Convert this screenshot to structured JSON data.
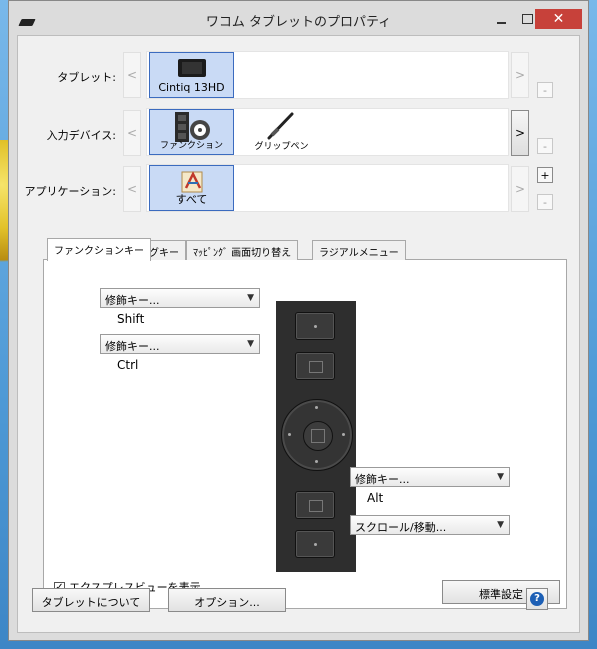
{
  "window": {
    "title": "ワコム タブレットのプロパティ",
    "close_glyph": "✕"
  },
  "rows": {
    "tablet": {
      "label": "タブレット:",
      "prev": "<",
      "next": ">",
      "minus": "-",
      "items": [
        {
          "label": "Cintiq 13HD",
          "icon": "tablet-icon",
          "selected": true
        }
      ]
    },
    "input_device": {
      "label": "入力デバイス:",
      "prev": "<",
      "next": ">",
      "minus": "-",
      "items": [
        {
          "label": "ファンクション",
          "icon": "express-keys-icon",
          "selected": true
        },
        {
          "label": "グリップペン",
          "icon": "grip-pen-icon",
          "selected": false
        }
      ]
    },
    "application": {
      "label": "アプリケーション:",
      "prev": "<",
      "next": ">",
      "plus": "+",
      "minus": "-",
      "items": [
        {
          "label": "すべて",
          "icon": "all-applications-icon",
          "selected": true
        }
      ]
    }
  },
  "tabs": [
    {
      "label": "ファンクションキー",
      "active": true
    },
    {
      "label": "リングキー",
      "active": false
    },
    {
      "label": "ﾏｯﾋﾟﾝｸﾞ 画面切り替え",
      "active": false
    },
    {
      "label": "ラジアルメニュー",
      "active": false
    }
  ],
  "function_keys": {
    "top1": {
      "value": "修飾キー...",
      "sub": "Shift"
    },
    "top2": {
      "value": "修飾キー...",
      "sub": "Ctrl"
    },
    "bottom1": {
      "value": "修飾キー...",
      "sub": "Alt"
    },
    "bottom2": {
      "value": "スクロール/移動..."
    }
  },
  "express_view": {
    "label": "エクスプレスビューを表示",
    "checked": true,
    "check_glyph": "✓"
  },
  "buttons": {
    "default": "標準設定",
    "about": "タブレットについて",
    "options": "オプション...",
    "help": "?"
  },
  "colors": {
    "selected_tile": "#c9daf5",
    "close_button": "#c7413a",
    "help_icon": "#1c5fb5",
    "device_body": "#2e2e2e"
  }
}
